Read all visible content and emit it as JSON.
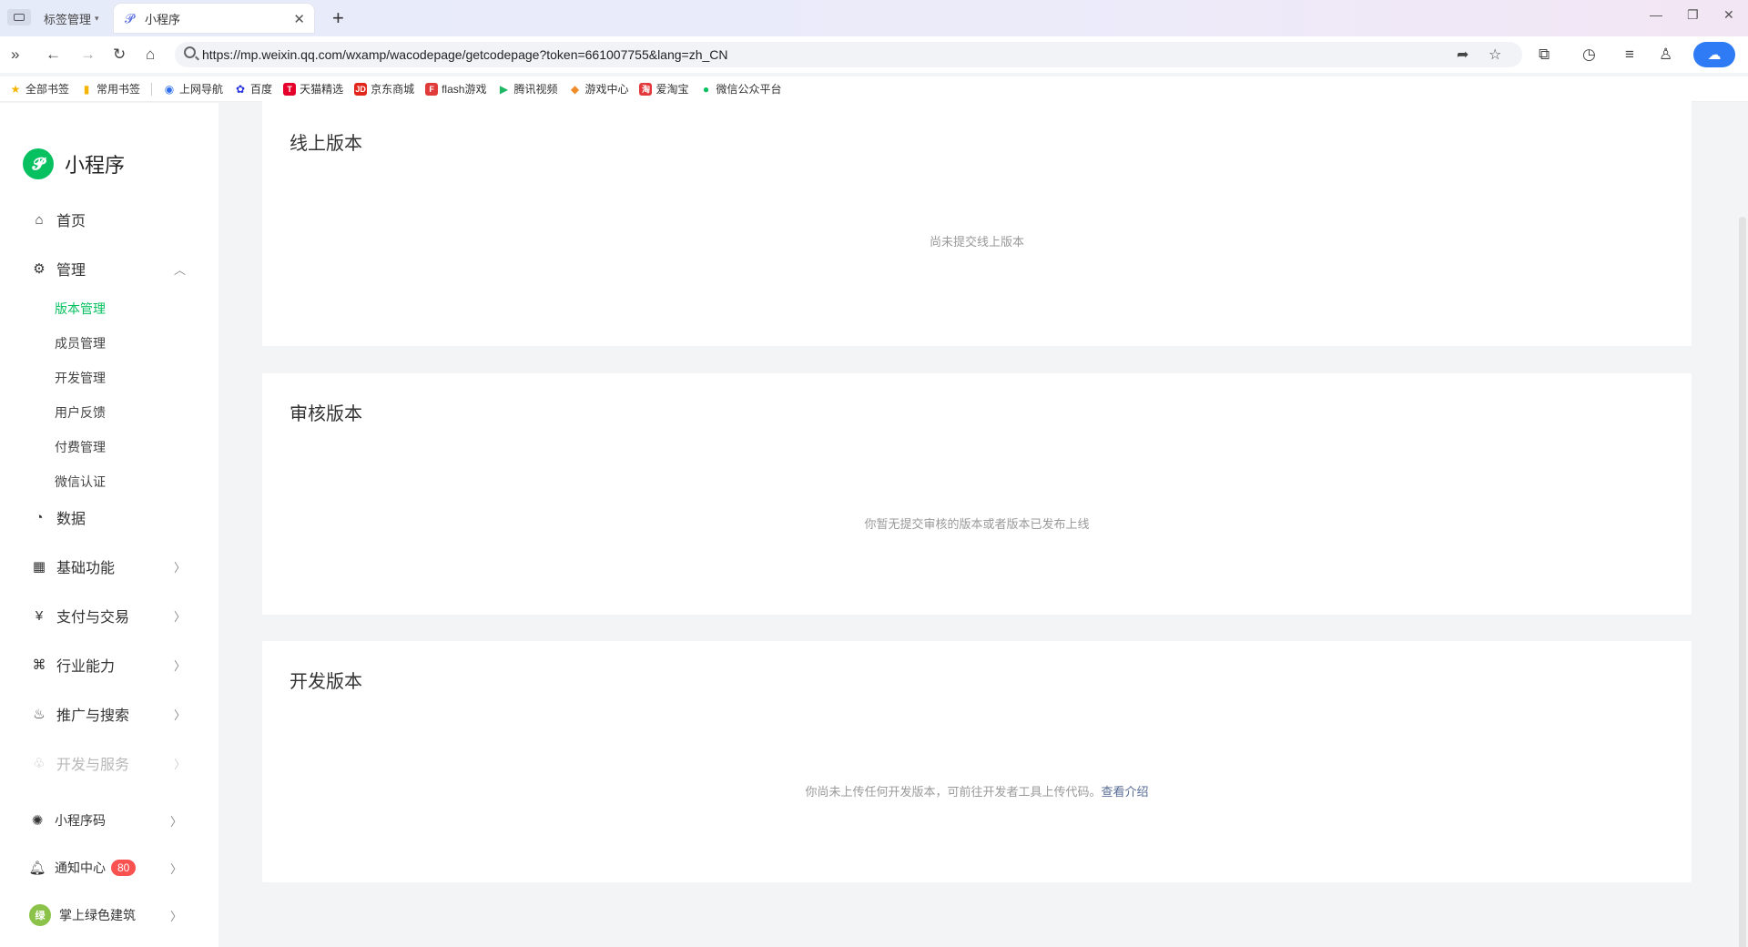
{
  "browser": {
    "inactive_tab_label": "标签管理",
    "active_tab_title": "小程序",
    "url": "https://mp.weixin.qq.com/wxamp/wacodepage/getcodepage?token=661007755&lang=zh_CN",
    "bookmarks": [
      {
        "label": "全部书签",
        "icon": "star-icon",
        "color": "#f5b400"
      },
      {
        "label": "常用书签",
        "icon": "bookmark-icon",
        "color": "#f5b400"
      },
      {
        "label": "上网导航",
        "icon": "nav-icon",
        "color": "#2f6fed"
      },
      {
        "label": "百度",
        "icon": "baidu-paw-icon",
        "color": "#2932e1"
      },
      {
        "label": "天猫精选",
        "icon": "tmall-icon",
        "color": "#e4002b"
      },
      {
        "label": "京东商城",
        "icon": "jd-icon",
        "color": "#e1251b"
      },
      {
        "label": "flash游戏",
        "icon": "flash-game-icon",
        "color": "#e03a3a"
      },
      {
        "label": "腾讯视频",
        "icon": "tencent-video-icon",
        "color": "#20b864"
      },
      {
        "label": "游戏中心",
        "icon": "gamepad-icon",
        "color": "#f08c2a"
      },
      {
        "label": "爱淘宝",
        "icon": "taobao-icon",
        "color": "#e4393c"
      },
      {
        "label": "微信公众平台",
        "icon": "wechat-icon",
        "color": "#07c160"
      }
    ]
  },
  "sidebar": {
    "brand": "小程序",
    "nav": [
      {
        "label": "首页",
        "icon": "home-icon"
      },
      {
        "label": "管理",
        "icon": "settings-icon",
        "expanded": true
      },
      {
        "label": "数据",
        "icon": "pie-chart-icon"
      },
      {
        "label": "基础功能",
        "icon": "grid-icon"
      },
      {
        "label": "支付与交易",
        "icon": "yen-icon"
      },
      {
        "label": "行业能力",
        "icon": "industry-icon"
      },
      {
        "label": "推广与搜索",
        "icon": "flame-icon"
      },
      {
        "label": "开发与服务",
        "icon": "dev-service-icon",
        "disabled": true
      }
    ],
    "sub_items": [
      "版本管理",
      "成员管理",
      "开发管理",
      "用户反馈",
      "付费管理",
      "微信认证"
    ],
    "active_sub": "版本管理",
    "bottom": {
      "qrcode_label": "小程序码",
      "notify_label": "通知中心",
      "notify_count": "80",
      "account_label": "掌上绿色建筑"
    }
  },
  "main": {
    "online": {
      "title": "线上版本",
      "empty": "尚未提交线上版本"
    },
    "review": {
      "title": "审核版本",
      "empty": "你暂无提交审核的版本或者版本已发布上线"
    },
    "dev": {
      "title": "开发版本",
      "empty": "你尚未上传任何开发版本，可前往开发者工具上传代码。",
      "link": "查看介绍"
    }
  },
  "colors": {
    "accent": "#07c160",
    "link": "#576b95",
    "badge": "#fa5151"
  }
}
